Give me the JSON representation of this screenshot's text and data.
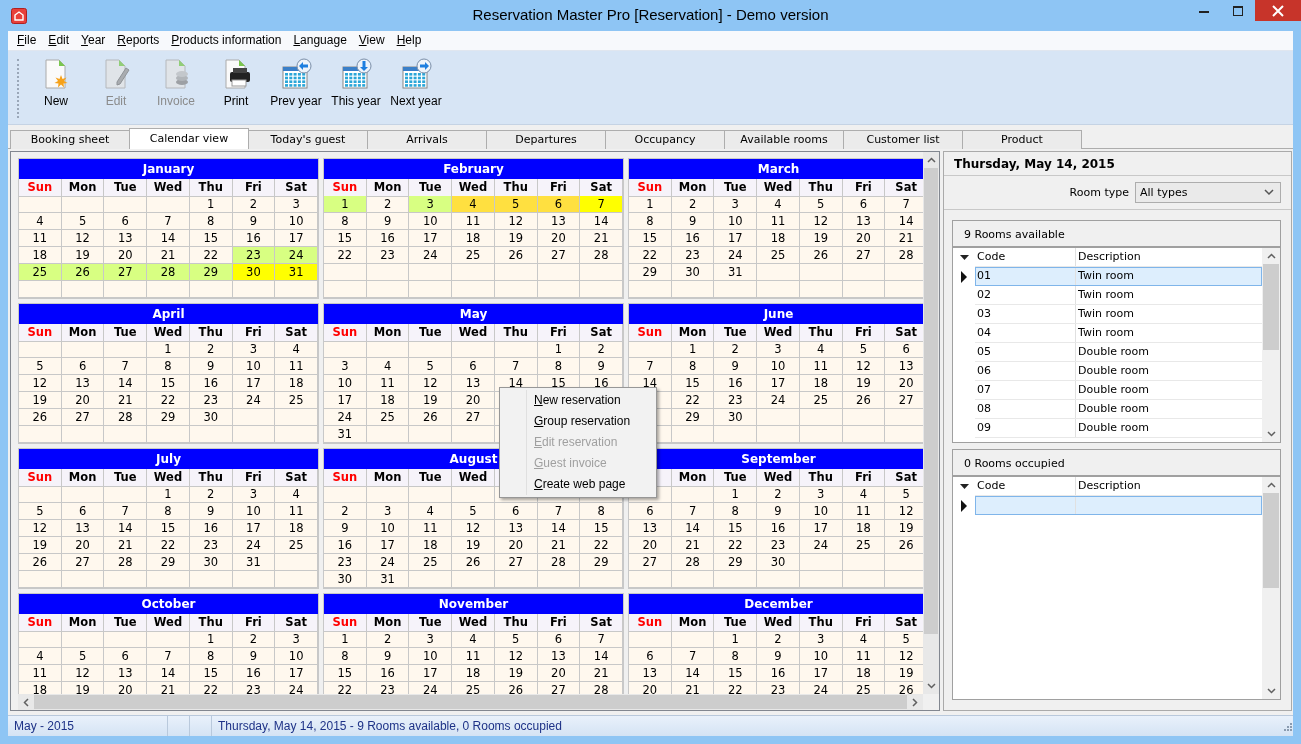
{
  "window": {
    "title": "Reservation Master Pro [Reservation] - Demo version"
  },
  "menu": [
    {
      "label": "File",
      "underlined_initial": true
    },
    {
      "label": "Edit",
      "underlined_initial": true
    },
    {
      "label": "Year",
      "underlined_initial": true
    },
    {
      "label": "Reports",
      "underlined_initial": true
    },
    {
      "label": "Products information",
      "underlined_initial": true
    },
    {
      "label": "Language",
      "underlined_initial": true
    },
    {
      "label": "View",
      "underlined_initial": true
    },
    {
      "label": "Help",
      "underlined_initial": true
    }
  ],
  "toolbar": [
    {
      "label": "New",
      "kind": "new",
      "disabled": false
    },
    {
      "label": "Edit",
      "kind": "edit",
      "disabled": true
    },
    {
      "label": "Invoice",
      "kind": "invoice",
      "disabled": true
    },
    {
      "label": "Print",
      "kind": "print",
      "disabled": false
    },
    {
      "label": "Prev year",
      "kind": "prev",
      "disabled": false
    },
    {
      "label": "This year",
      "kind": "this",
      "disabled": false
    },
    {
      "label": "Next year",
      "kind": "next",
      "disabled": false
    }
  ],
  "tabs": [
    {
      "label": "Booking sheet",
      "selected": false
    },
    {
      "label": "Calendar view",
      "selected": true
    },
    {
      "label": "Today's guest",
      "selected": false
    },
    {
      "label": "Arrivals",
      "selected": false
    },
    {
      "label": "Departures",
      "selected": false
    },
    {
      "label": "Occupancy",
      "selected": false
    },
    {
      "label": "Available rooms",
      "selected": false
    },
    {
      "label": "Customer list",
      "selected": false
    },
    {
      "label": "Product",
      "selected": false
    }
  ],
  "calendar": {
    "months": [
      {
        "name": "January",
        "weekdays": [
          "Sun",
          "Mon",
          "Tue",
          "Wed",
          "Thu",
          "Fri",
          "Sat"
        ],
        "weeks": [
          [
            {
              "kind": "blank"
            },
            {
              "kind": "blank"
            },
            {
              "kind": "blank"
            },
            {
              "kind": "blank"
            },
            "1",
            "2",
            "3"
          ],
          [
            "4",
            "5",
            "6",
            "7",
            "8",
            "9",
            "10"
          ],
          [
            "11",
            "12",
            "13",
            "14",
            "15",
            "16",
            "17"
          ],
          [
            "18",
            "19",
            "20",
            "21",
            "22",
            {
              "kind": "day",
              "day": "23",
              "color": "#d8ff82"
            },
            {
              "kind": "day",
              "day": "24",
              "color": "#d8ff82"
            }
          ],
          [
            {
              "kind": "day",
              "day": "25",
              "color": "#d8ff82"
            },
            {
              "kind": "day",
              "day": "26",
              "color": "#d8ff82"
            },
            {
              "kind": "day",
              "day": "27",
              "color": "#d8ff82"
            },
            {
              "kind": "day",
              "day": "28",
              "color": "#d8ff82"
            },
            {
              "kind": "day",
              "day": "29",
              "color": "#d8ff82"
            },
            {
              "kind": "day",
              "day": "30",
              "color": "#ffff00"
            },
            {
              "kind": "day",
              "day": "31",
              "color": "#ffff00"
            }
          ]
        ]
      },
      {
        "name": "February",
        "weekdays": [
          "Sun",
          "Mon",
          "Tue",
          "Wed",
          "Thu",
          "Fri",
          "Sat"
        ],
        "weeks": [
          [
            {
              "kind": "day",
              "day": "1",
              "color": "#d8ff82"
            },
            "2",
            {
              "kind": "day",
              "day": "3",
              "color": "#d8ff82"
            },
            {
              "kind": "day",
              "day": "4",
              "color": "#ffe040"
            },
            {
              "kind": "day",
              "day": "5",
              "color": "#ffe040"
            },
            {
              "kind": "day",
              "day": "6",
              "color": "#ffe040"
            },
            {
              "kind": "day",
              "day": "7",
              "color": "#ffff00"
            }
          ],
          [
            "8",
            "9",
            "10",
            "11",
            "12",
            "13",
            "14"
          ],
          [
            "15",
            "16",
            "17",
            "18",
            "19",
            "20",
            "21"
          ],
          [
            "22",
            "23",
            "24",
            "25",
            "26",
            "27",
            "28"
          ]
        ]
      },
      {
        "name": "March",
        "weekdays": [
          "Sun",
          "Mon",
          "Tue",
          "Wed",
          "Thu",
          "Fri",
          "Sat"
        ],
        "weeks": [
          [
            "1",
            "2",
            "3",
            "4",
            "5",
            "6",
            "7"
          ],
          [
            "8",
            "9",
            "10",
            "11",
            "12",
            "13",
            "14"
          ],
          [
            "15",
            "16",
            "17",
            "18",
            "19",
            "20",
            "21"
          ],
          [
            "22",
            "23",
            "24",
            "25",
            "26",
            "27",
            "28"
          ],
          [
            "29",
            "30",
            "31"
          ]
        ]
      },
      {
        "name": "April",
        "weekdays": [
          "Sun",
          "Mon",
          "Tue",
          "Wed",
          "Thu",
          "Fri",
          "Sat"
        ],
        "weeks": [
          [
            {
              "kind": "blank"
            },
            {
              "kind": "blank"
            },
            {
              "kind": "blank"
            },
            "1",
            "2",
            "3",
            "4"
          ],
          [
            "5",
            "6",
            "7",
            "8",
            "9",
            "10",
            "11"
          ],
          [
            "12",
            "13",
            "14",
            "15",
            "16",
            "17",
            "18"
          ],
          [
            "19",
            "20",
            "21",
            "22",
            "23",
            "24",
            "25"
          ],
          [
            "26",
            "27",
            "28",
            "29",
            "30"
          ]
        ]
      },
      {
        "name": "May",
        "weekdays": [
          "Sun",
          "Mon",
          "Tue",
          "Wed",
          "Thu",
          "Fri",
          "Sat"
        ],
        "weeks": [
          [
            {
              "kind": "blank"
            },
            {
              "kind": "blank"
            },
            {
              "kind": "blank"
            },
            {
              "kind": "blank"
            },
            {
              "kind": "blank"
            },
            "1",
            "2"
          ],
          [
            "3",
            "4",
            "5",
            "6",
            "7",
            "8",
            "9"
          ],
          [
            "10",
            "11",
            "12",
            "13",
            "14",
            "15",
            "16"
          ],
          [
            "17",
            "18",
            "19",
            "20"
          ],
          [
            "24",
            "25",
            "26",
            "27"
          ],
          [
            "31"
          ]
        ]
      },
      {
        "name": "June",
        "weekdays": [
          "Sun",
          "Mon",
          "Tue",
          "Wed",
          "Thu",
          "Fri",
          "Sat"
        ],
        "weeks": [
          [
            {
              "kind": "blank"
            },
            "1",
            "2",
            "3",
            "4",
            "5",
            "6"
          ],
          [
            "7",
            "8",
            "9",
            "10",
            "11",
            "12",
            "13"
          ],
          [
            "14",
            "15",
            "16",
            "17",
            "18",
            "19",
            "20"
          ],
          [
            {
              "kind": "blank"
            },
            "22",
            "23",
            "24",
            "25",
            "26",
            "27"
          ],
          [
            {
              "kind": "blank"
            },
            "29",
            "30"
          ]
        ]
      },
      {
        "name": "July",
        "weekdays": [
          "Sun",
          "Mon",
          "Tue",
          "Wed",
          "Thu",
          "Fri",
          "Sat"
        ],
        "weeks": [
          [
            {
              "kind": "blank"
            },
            {
              "kind": "blank"
            },
            {
              "kind": "blank"
            },
            "1",
            "2",
            "3",
            "4"
          ],
          [
            "5",
            "6",
            "7",
            "8",
            "9",
            "10",
            "11"
          ],
          [
            "12",
            "13",
            "14",
            "15",
            "16",
            "17",
            "18"
          ],
          [
            "19",
            "20",
            "21",
            "22",
            "23",
            "24",
            "25"
          ],
          [
            "26",
            "27",
            "28",
            "29",
            "30",
            "31"
          ]
        ]
      },
      {
        "name": "August",
        "weekdays": [
          "Sun",
          "Mon",
          "Tue",
          "Wed"
        ],
        "weeks": [
          [
            {
              "kind": "blank"
            }
          ],
          [
            "2",
            "3",
            "4",
            "5",
            "6",
            "7",
            "8"
          ],
          [
            "9",
            "10",
            "11",
            "12",
            "13",
            "14",
            "15"
          ],
          [
            "16",
            "17",
            "18",
            "19",
            "20",
            "21",
            "22"
          ],
          [
            "23",
            "24",
            "25",
            "26",
            "27",
            "28",
            "29"
          ],
          [
            "30",
            "31"
          ]
        ]
      },
      {
        "name": "September",
        "weekdays": [
          {
            "kind": "blank"
          },
          "Mon",
          "Tue",
          "Wed",
          "Thu",
          "Fri",
          "Sat"
        ],
        "weeks": [
          [
            {
              "kind": "blank"
            },
            {
              "kind": "blank"
            },
            "1",
            "2",
            "3",
            "4",
            "5"
          ],
          [
            "6",
            "7",
            "8",
            "9",
            "10",
            "11",
            "12"
          ],
          [
            "13",
            "14",
            "15",
            "16",
            "17",
            "18",
            "19"
          ],
          [
            "20",
            "21",
            "22",
            "23",
            "24",
            "25",
            "26"
          ],
          [
            "27",
            "28",
            "29",
            "30"
          ]
        ]
      },
      {
        "name": "October",
        "weekdays": [
          "Sun",
          "Mon",
          "Tue",
          "Wed",
          "Thu",
          "Fri",
          "Sat"
        ],
        "weeks": [
          [
            {
              "kind": "blank"
            },
            {
              "kind": "blank"
            },
            {
              "kind": "blank"
            },
            {
              "kind": "blank"
            },
            "1",
            "2",
            "3"
          ],
          [
            "4",
            "5",
            "6",
            "7",
            "8",
            "9",
            "10"
          ],
          [
            "11",
            "12",
            "13",
            "14",
            "15",
            "16",
            "17"
          ],
          [
            "18",
            "19",
            "20",
            "21",
            "22",
            "23",
            "24"
          ]
        ]
      },
      {
        "name": "November",
        "weekdays": [
          "Sun",
          "Mon",
          "Tue",
          "Wed",
          "Thu",
          "Fri",
          "Sat"
        ],
        "weeks": [
          [
            "1",
            "2",
            "3",
            "4",
            "5",
            "6",
            "7"
          ],
          [
            "8",
            "9",
            "10",
            "11",
            "12",
            "13",
            "14"
          ],
          [
            "15",
            "16",
            "17",
            "18",
            "19",
            "20",
            "21"
          ],
          [
            "22",
            "23",
            "24",
            "25",
            "26",
            "27",
            "28"
          ]
        ]
      },
      {
        "name": "December",
        "weekdays": [
          "Sun",
          "Mon",
          "Tue",
          "Wed",
          "Thu",
          "Fri",
          "Sat"
        ],
        "weeks": [
          [
            {
              "kind": "blank"
            },
            {
              "kind": "blank"
            },
            "1",
            "2",
            "3",
            "4",
            "5"
          ],
          [
            "6",
            "7",
            "8",
            "9",
            "10",
            "11",
            "12"
          ],
          [
            "13",
            "14",
            "15",
            "16",
            "17",
            "18",
            "19"
          ],
          [
            "20",
            "21",
            "22",
            "23",
            "24",
            "25",
            "26"
          ]
        ]
      }
    ]
  },
  "context_menu": {
    "items": [
      {
        "label": "New reservation",
        "disabled": false,
        "underlined_initial": true
      },
      {
        "label": "Group reservation",
        "disabled": false,
        "underlined_initial": true
      },
      {
        "label": "Edit reservation",
        "disabled": true,
        "underlined_initial": true
      },
      {
        "label": "Guest invoice",
        "disabled": true,
        "underlined_initial": true
      },
      {
        "label": "Create web page",
        "disabled": false,
        "underlined_initial": true
      }
    ]
  },
  "side_panel": {
    "date": "Thursday, May 14, 2015",
    "room_type": {
      "label": "Room type",
      "value": "All types"
    },
    "available": {
      "title": "9 Rooms available",
      "columns": [
        "Code",
        "Description"
      ],
      "rows": [
        {
          "code": "01",
          "description": "Twin room",
          "selected": true
        },
        {
          "code": "02",
          "description": "Twin room",
          "selected": false
        },
        {
          "code": "03",
          "description": "Twin room",
          "selected": false
        },
        {
          "code": "04",
          "description": "Twin room",
          "selected": false
        },
        {
          "code": "05",
          "description": "Double room",
          "selected": false
        },
        {
          "code": "06",
          "description": "Double room",
          "selected": false
        },
        {
          "code": "07",
          "description": "Double room",
          "selected": false
        },
        {
          "code": "08",
          "description": "Double room",
          "selected": false
        },
        {
          "code": "09",
          "description": "Double room",
          "selected": false
        }
      ]
    },
    "occupied": {
      "title": "0 Rooms occupied",
      "columns": [
        "Code",
        "Description"
      ],
      "rows": [
        {
          "selected": true
        }
      ]
    }
  },
  "status_bar": {
    "panels": [
      "May - 2015",
      "Thursday, May 14, 2015 - 9 Rooms available, 0 Rooms occupied"
    ]
  }
}
